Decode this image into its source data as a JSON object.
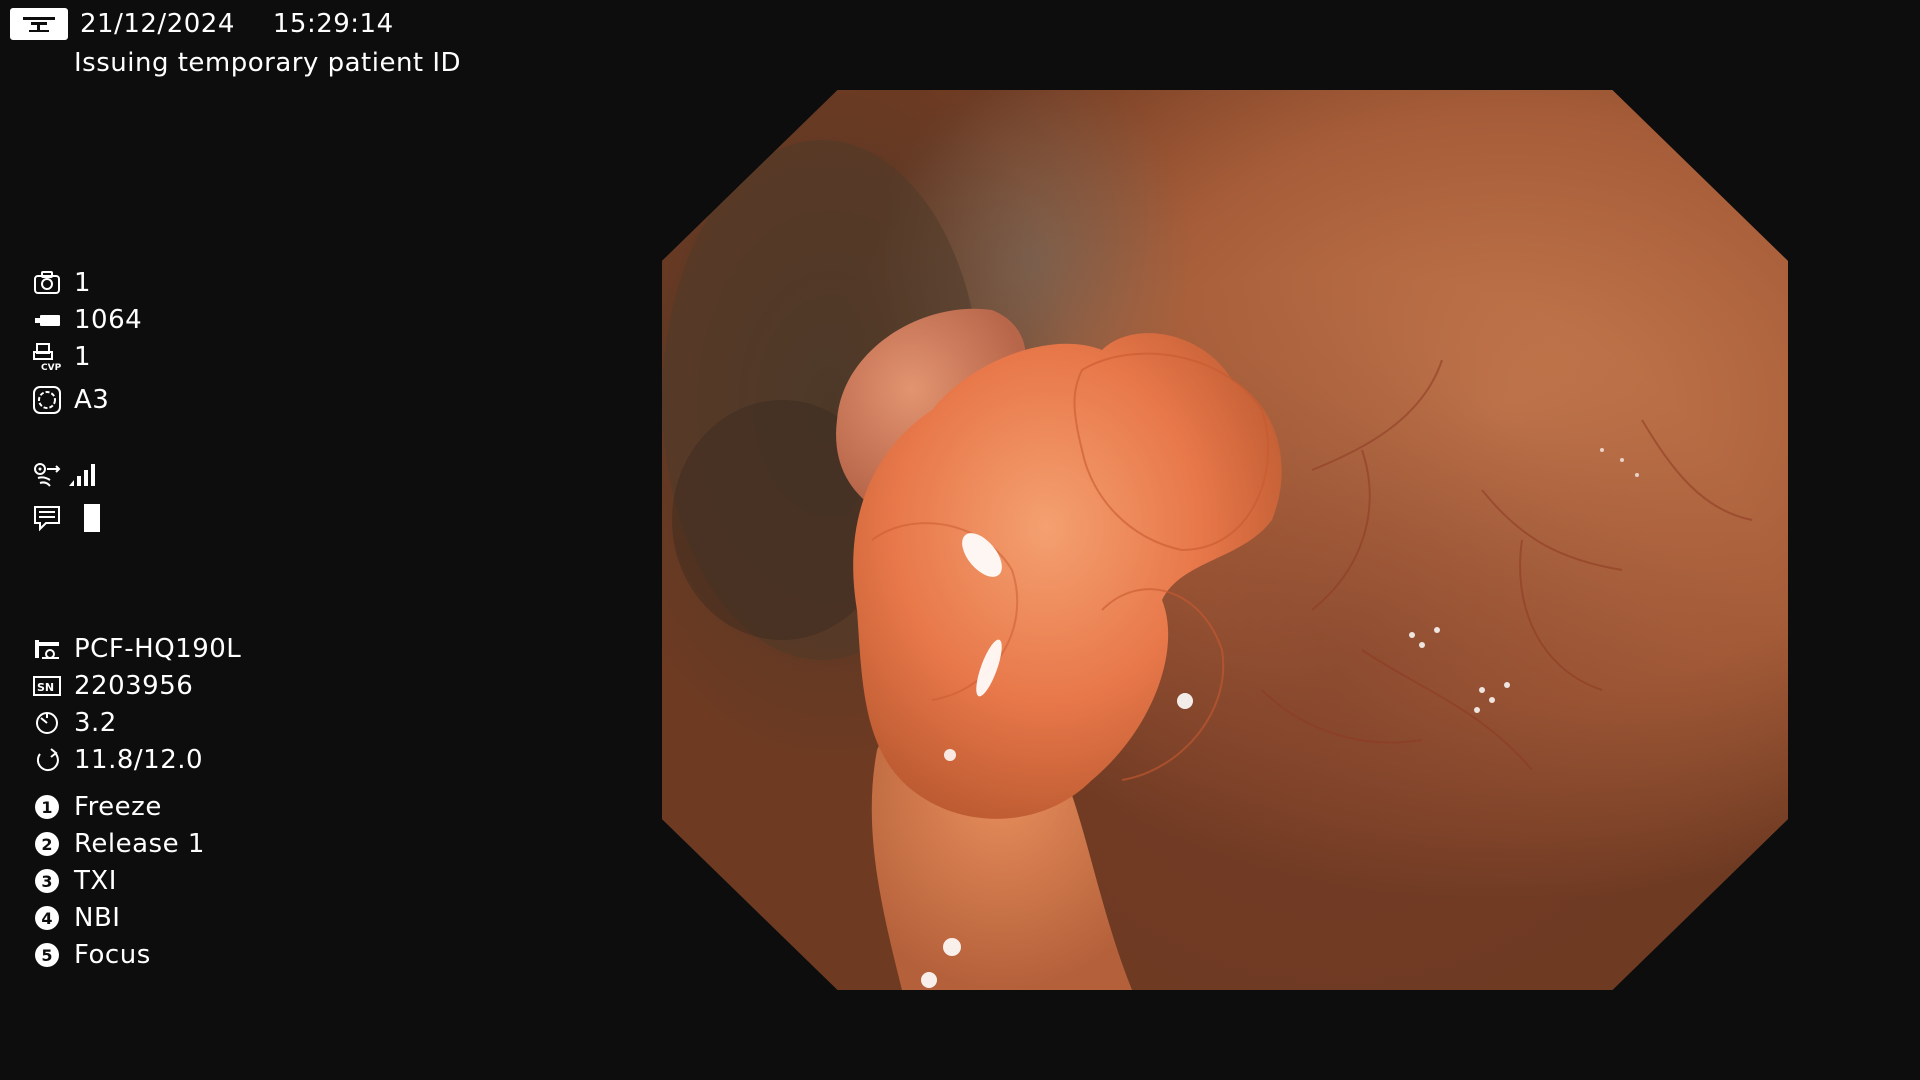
{
  "header": {
    "date": "21/12/2024",
    "time": "15:29:14",
    "status": "Issuing temporary patient ID"
  },
  "counters": {
    "capture_count": "1",
    "storage_count": "1064",
    "cvp_count": "1",
    "mode": "A3"
  },
  "scope_info": {
    "model": "PCF-HQ190L",
    "serial": "2203956",
    "value_1": "3.2",
    "value_2": "11.8/12.0"
  },
  "buttons": [
    {
      "num": "1",
      "label": "Freeze"
    },
    {
      "num": "2",
      "label": "Release 1"
    },
    {
      "num": "3",
      "label": "TXI"
    },
    {
      "num": "4",
      "label": "NBI"
    },
    {
      "num": "5",
      "label": "Focus"
    }
  ],
  "icons": {
    "monitor": "monitor-icon",
    "camera": "camera-icon",
    "storage": "storage-icon",
    "printer": "printer-icon",
    "mode": "mode-icon",
    "signal": "signal-icon",
    "comment": "comment-icon",
    "scope": "scope-icon",
    "serial": "sn-icon",
    "rotate": "rotate-icon",
    "rotate_ccw": "rotate-ccw-icon"
  },
  "colors": {
    "background": "#0d0d0d",
    "text": "#ffffff"
  }
}
